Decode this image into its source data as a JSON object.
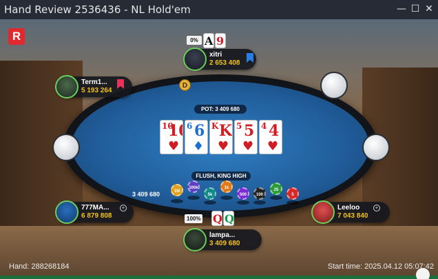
{
  "window": {
    "title": "Hand Review 2536436 - NL Hold'em",
    "minimize_icon": "minimize-icon",
    "maximize_icon": "maximize-icon",
    "close_icon": "close-icon"
  },
  "logo": {
    "letter": "R",
    "color": "#e0282e"
  },
  "dealer_button": {
    "label": "D"
  },
  "pot": {
    "label": "POT: 3 409 680"
  },
  "hand_result": {
    "label": "FLUSH, KING HIGH"
  },
  "board": {
    "cards": [
      {
        "rank": "10",
        "suit": "♥",
        "color": "red"
      },
      {
        "rank": "6",
        "suit": "♦",
        "color": "blue"
      },
      {
        "rank": "K",
        "suit": "♥",
        "color": "red"
      },
      {
        "rank": "5",
        "suit": "♥",
        "color": "red"
      },
      {
        "rank": "4",
        "suit": "♥",
        "color": "red"
      }
    ]
  },
  "players": {
    "top": {
      "name": "xitri",
      "stack": "2 653 408",
      "equity": "0%",
      "cards": [
        {
          "rank": "A",
          "color": "black"
        },
        {
          "rank": "9",
          "color": "red"
        }
      ],
      "bookmark_color": "#2a7de1"
    },
    "upper_left": {
      "name": "Term1...",
      "stack": "5 193 264",
      "bookmark_color": "#e8325a"
    },
    "lower_left": {
      "name": "777MA...",
      "stack": "6 879 808"
    },
    "right": {
      "name": "Leeloo",
      "stack": "7 043 840"
    },
    "bottom": {
      "name": "lampa...",
      "stack": "3 409 680",
      "equity": "100%",
      "cards": [
        {
          "rank": "Q",
          "color": "red"
        },
        {
          "rank": "Q",
          "color": "green"
        }
      ]
    }
  },
  "chips": {
    "total": "3 409 680",
    "stack": [
      {
        "label": "1M",
        "color": "#e0a020"
      },
      {
        "label": "100k",
        "color": "#5b3fc4"
      },
      {
        "label": "5k",
        "color": "#138a8a"
      },
      {
        "label": "1k",
        "color": "#e07a18"
      },
      {
        "label": "500",
        "color": "#7b2bd6"
      },
      {
        "label": "100",
        "color": "#222222"
      },
      {
        "label": "25",
        "color": "#2b9a3a"
      },
      {
        "label": "5",
        "color": "#d62a2a"
      }
    ]
  },
  "footer": {
    "hand_label": "Hand: 288268184",
    "start_time_label": "Start time: 2025.04.12 05:07:42"
  }
}
